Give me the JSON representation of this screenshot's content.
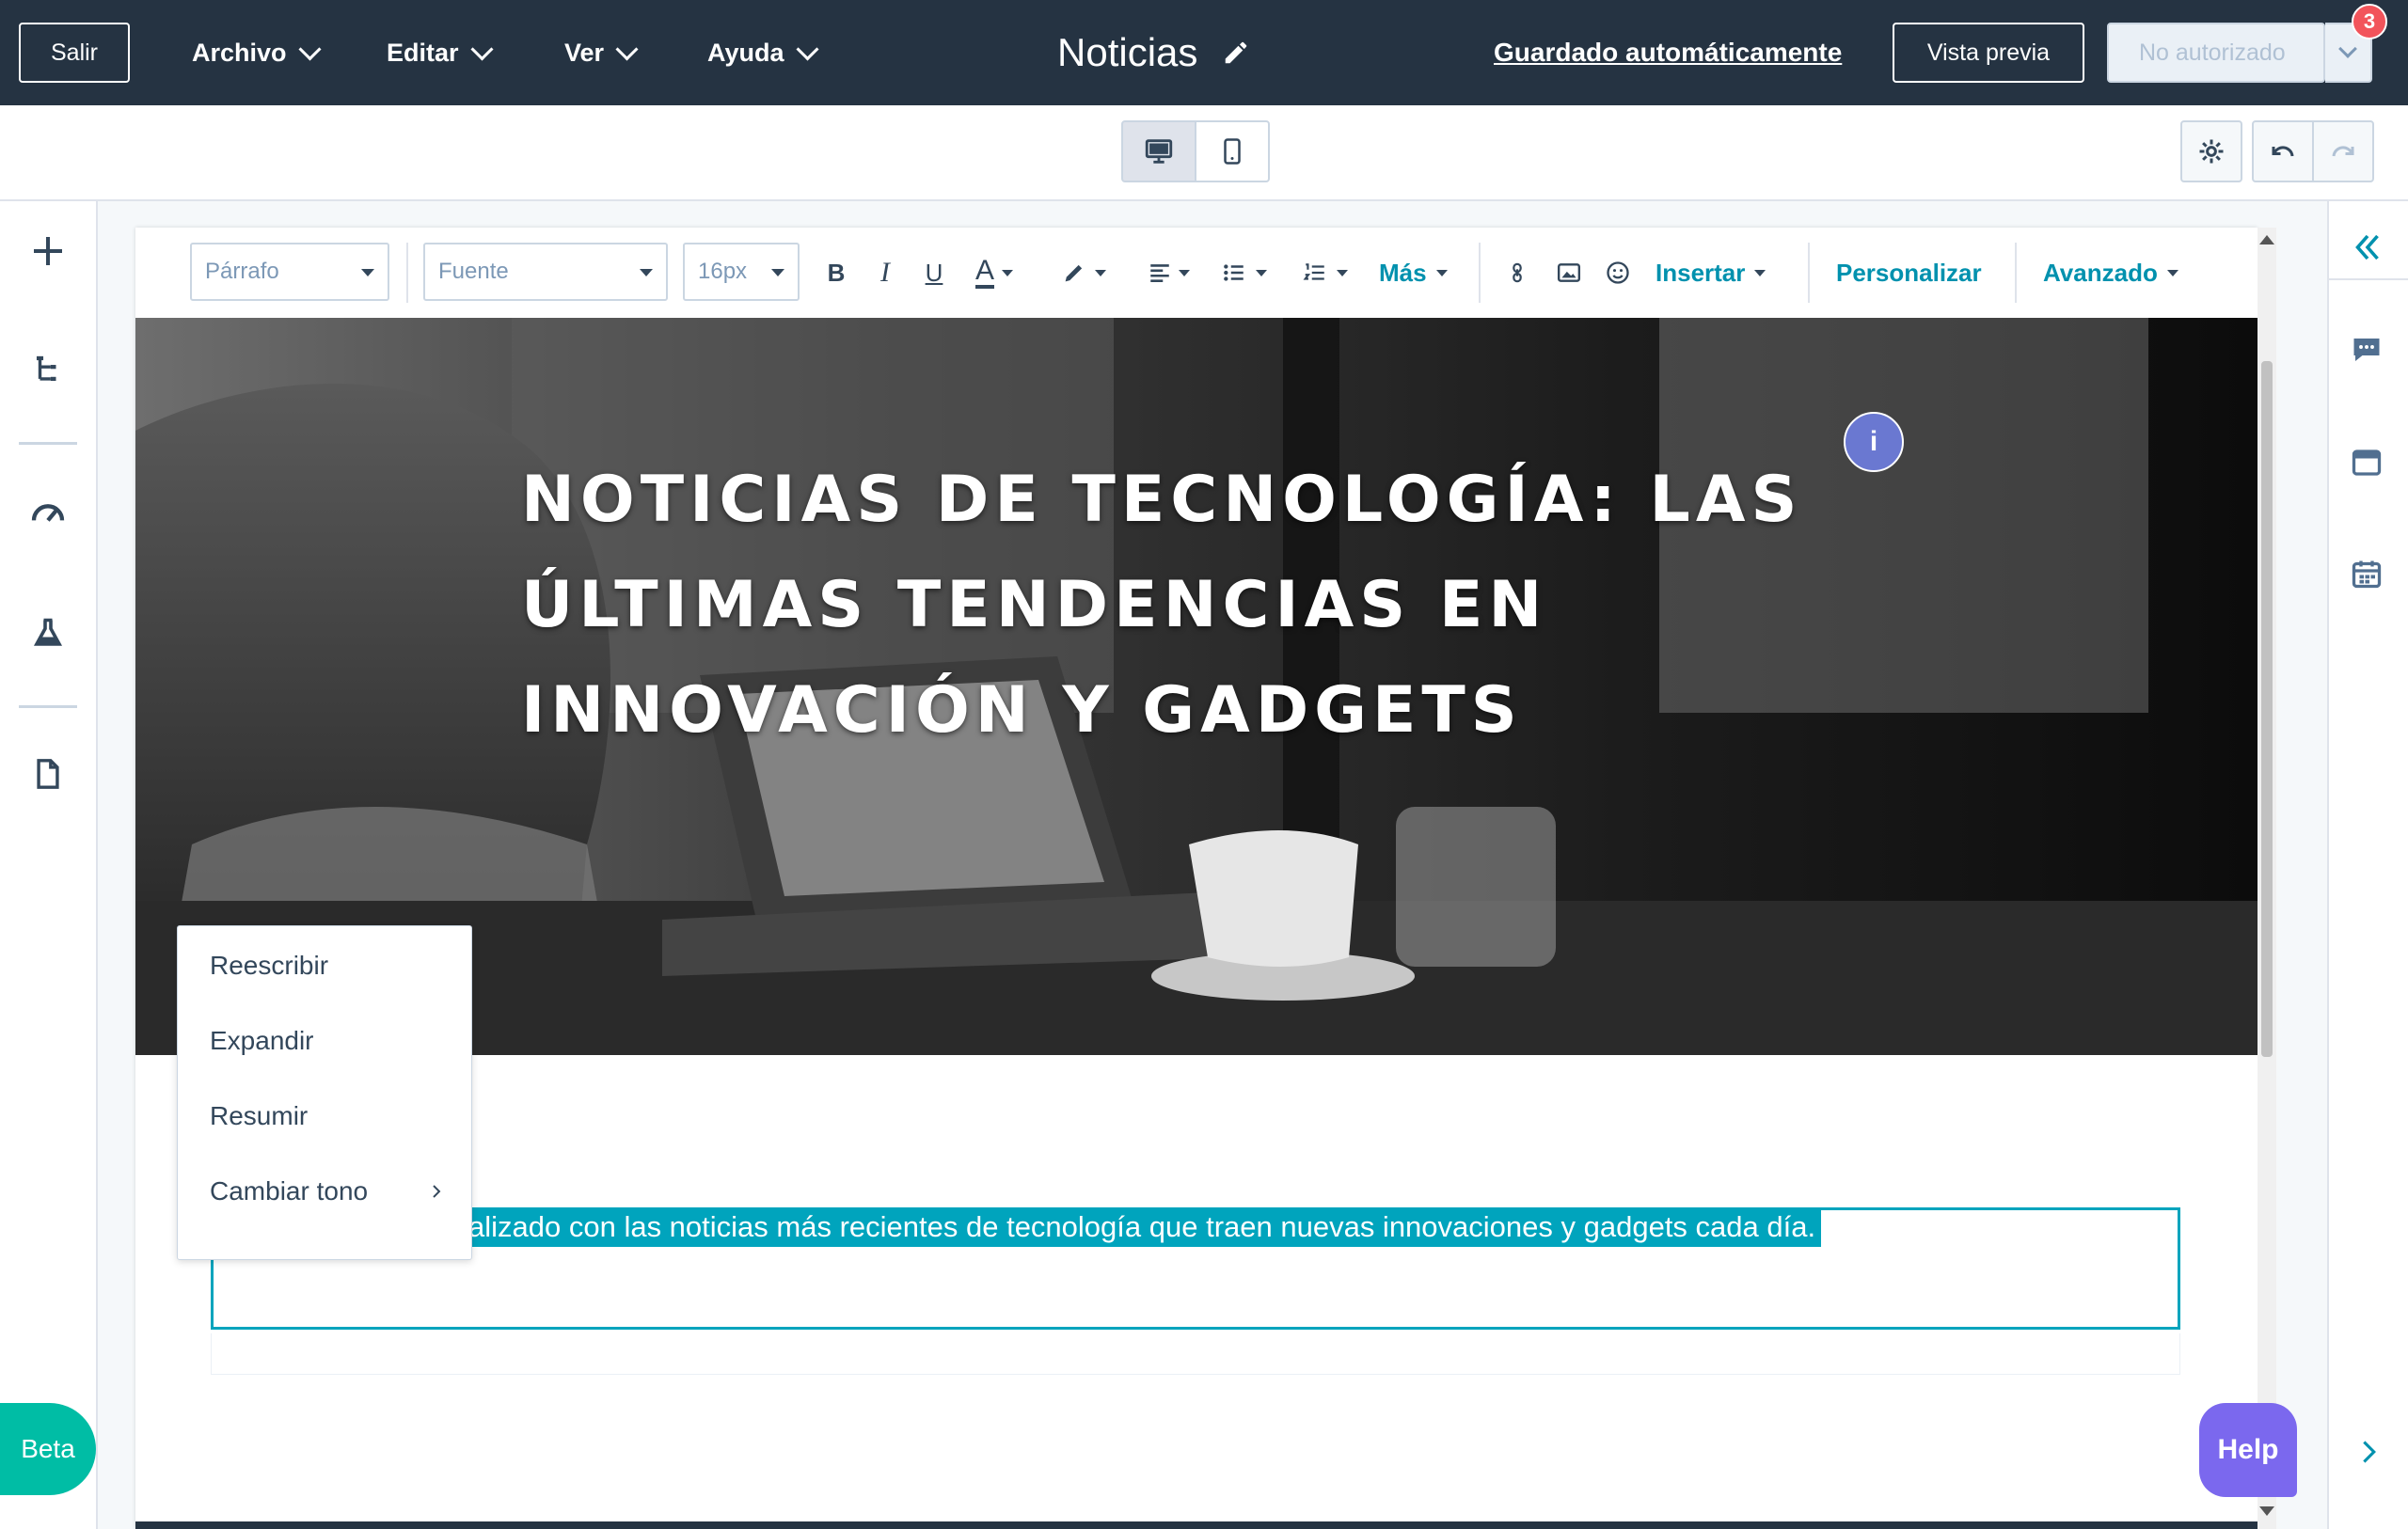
{
  "header": {
    "exit_label": "Salir",
    "menus": [
      {
        "label": "Archivo"
      },
      {
        "label": "Editar"
      },
      {
        "label": "Ver"
      },
      {
        "label": "Ayuda"
      }
    ],
    "page_name": "Noticias",
    "autosave_label": "Guardado automáticamente",
    "preview_label": "Vista previa",
    "publish_label": "No autorizado",
    "notification_count": "3"
  },
  "viewport_toggle": {
    "desktop_icon": "desktop-icon",
    "mobile_icon": "mobile-icon",
    "selected": "desktop"
  },
  "editor_toolbar": {
    "paragraph_style": "Párrafo",
    "font": "Fuente",
    "font_size": "16px",
    "bold": "B",
    "italic": "I",
    "underline": "U",
    "font_color_glyph": "A",
    "more_label": "Más",
    "insert_label": "Insertar",
    "customize_label": "Personalizar",
    "advanced_label": "Avanzado"
  },
  "hero": {
    "title_lines": [
      "NOTICIAS DE TECNOLOGÍA: LAS",
      "ÚLTIMAS TENDENCIAS EN",
      "INNOVACIÓN Y GADGETS"
    ],
    "info_glyph": "i"
  },
  "ai_menu": {
    "items": [
      {
        "label": "Reescribir"
      },
      {
        "label": "Expandir"
      },
      {
        "label": "Resumir"
      },
      {
        "label": "Cambiar tono"
      }
    ]
  },
  "body": {
    "selected_text": "alizado con las noticias más recientes de tecnología que traen nuevas innovaciones y gadgets cada día."
  },
  "beta_label": "Beta",
  "help_label": "Help",
  "colors": {
    "header_bg": "#253342",
    "accent": "#00a4bd",
    "link": "#0091ae",
    "badge": "#f2545b",
    "help": "#7b68ee"
  }
}
